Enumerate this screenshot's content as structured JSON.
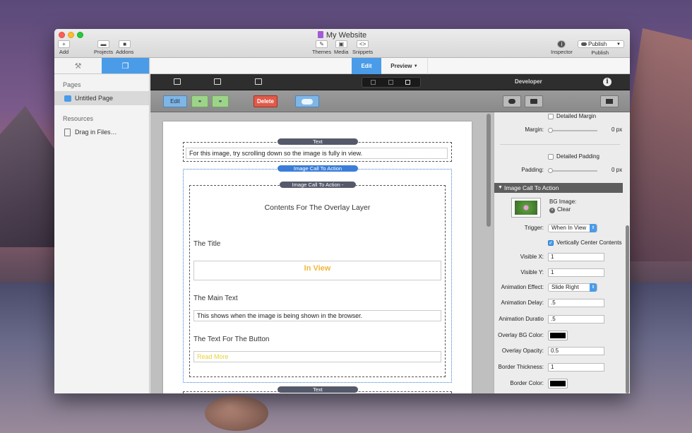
{
  "window": {
    "title": "My Website"
  },
  "toolbar": {
    "add": "Add",
    "projects": "Projects",
    "addons": "Addons",
    "themes": "Themes",
    "media": "Media",
    "snippets": "Snippets",
    "inspector": "Inspector",
    "publish": "Publish",
    "publish_label": "Publish"
  },
  "sidebar": {
    "pages_header": "Pages",
    "pages": [
      {
        "label": "Untitled Page"
      }
    ],
    "resources_header": "Resources",
    "resources": [
      {
        "label": "Drag in Files…"
      }
    ]
  },
  "mode": {
    "edit": "Edit",
    "preview": "Preview"
  },
  "editbar": {
    "edit": "Edit",
    "delete": "Delete"
  },
  "developer": {
    "label": "Developer"
  },
  "canvas": {
    "text_tag": "Text",
    "text_content": "For this image, try scrolling down so the image is fully in view.",
    "ica_tag": "Image Call To Action",
    "ica_inner_tag": "Image Call To Action -",
    "overlay_heading": "Contents For The Overlay Layer",
    "title_label": "The Title",
    "title_value": "In View",
    "main_text_label": "The Main Text",
    "main_text_value": "This shows when the image is being shown in the browser.",
    "button_label": "The Text For The Button",
    "button_value": "Read More",
    "bottom_tag": "Text"
  },
  "inspector": {
    "detailed_margin": "Detailed Margin",
    "margin_label": "Margin:",
    "margin_value": "0 px",
    "detailed_padding": "Detailed Padding",
    "padding_label": "Padding:",
    "padding_value": "0 px",
    "section": "Image Call To Action",
    "bg_image_label": "BG Image:",
    "clear": "Clear",
    "trigger_label": "Trigger:",
    "trigger_value": "When In View",
    "vcenter": "Vertically Center Contents",
    "visible_x_label": "Visible X:",
    "visible_x": "1",
    "visible_y_label": "Visible Y:",
    "visible_y": "1",
    "anim_effect_label": "Animation Effect:",
    "anim_effect": "Slide Right",
    "anim_delay_label": "Animation Delay:",
    "anim_delay": ".5",
    "anim_duration_label": "Animation Duratio",
    "anim_duration": ".5",
    "overlay_bg_label": "Overlay BG Color:",
    "overlay_bg_color": "#000000",
    "overlay_opacity_label": "Overlay Opacity:",
    "overlay_opacity": "0.5",
    "border_thickness_label": "Border Thickness:",
    "border_thickness": "1",
    "border_color_label": "Border Color:",
    "border_color": "#000000"
  },
  "colors": {
    "accent": "#4a9be8",
    "delete": "#e05a4a",
    "link": "#9ed48a",
    "in_view": "#f3b63a"
  }
}
